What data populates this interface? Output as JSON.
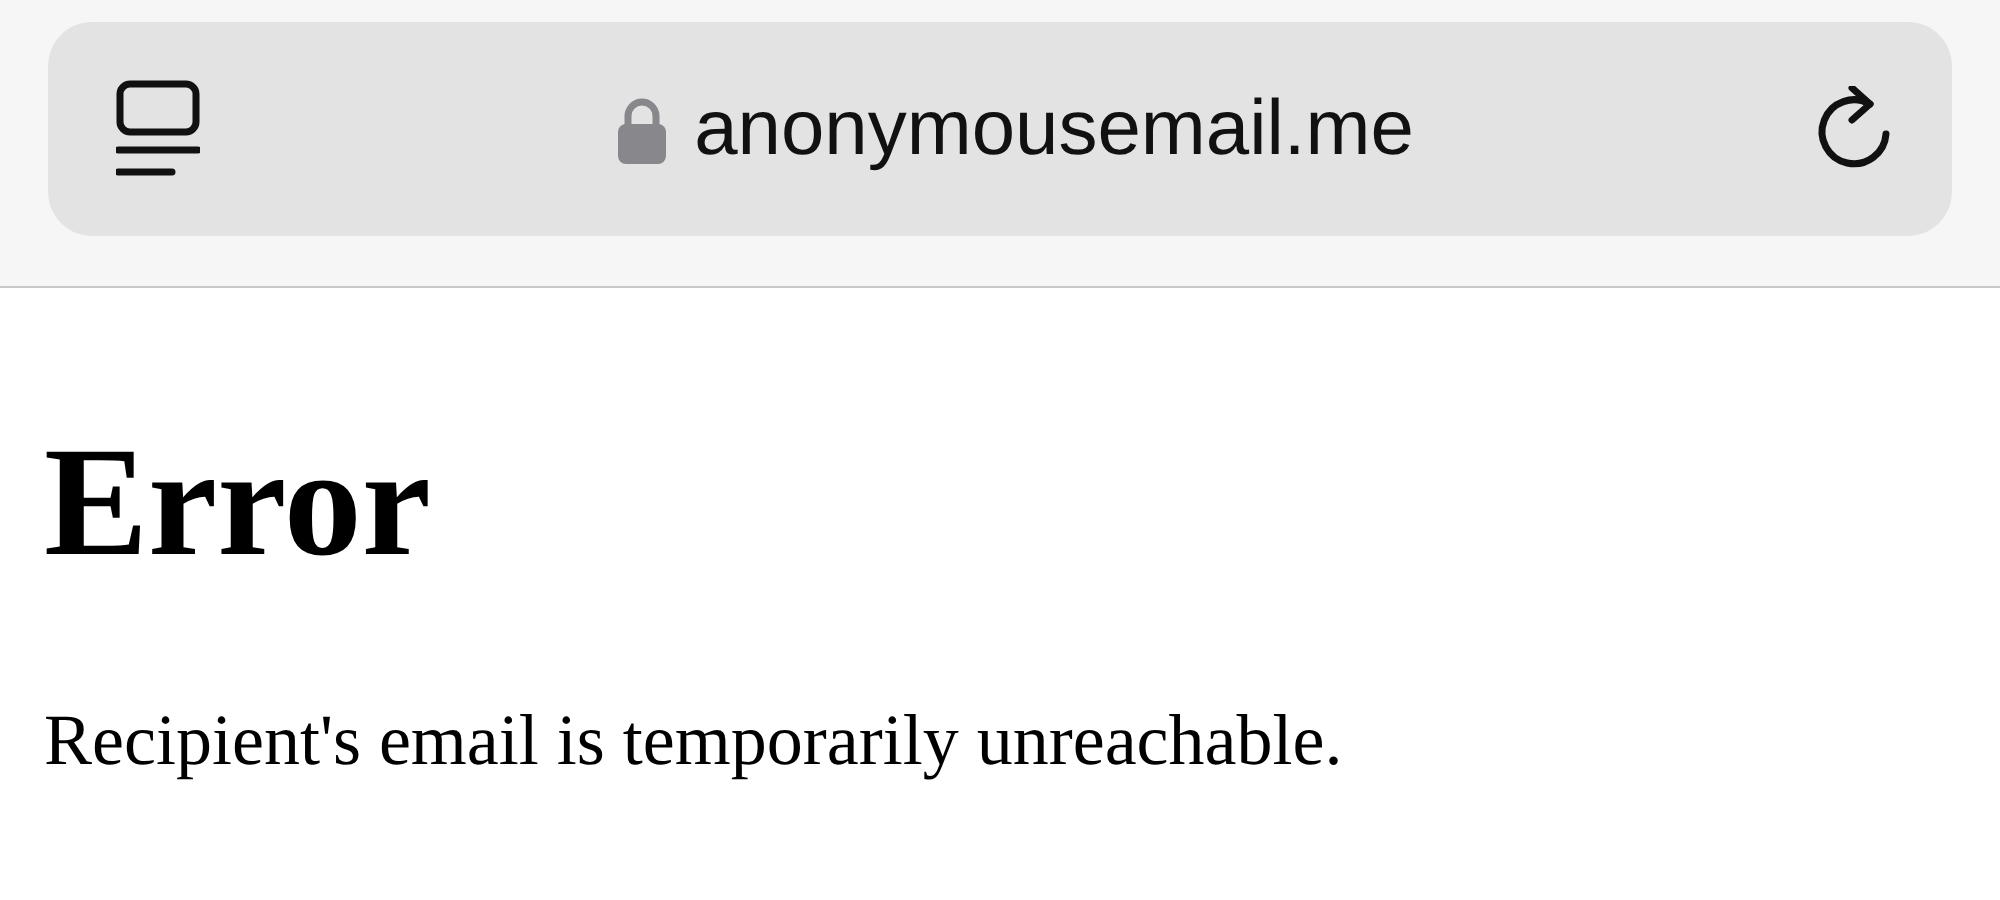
{
  "address_bar": {
    "url": "anonymousemail.me",
    "secure": true
  },
  "page": {
    "heading": "Error",
    "message": "Recipient's email is temporarily unreachable."
  }
}
